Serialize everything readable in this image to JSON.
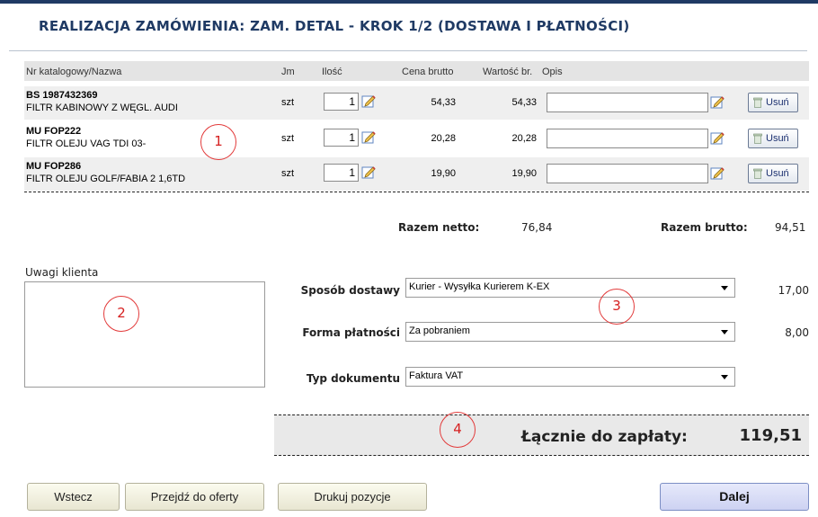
{
  "title": "REALIZACJA ZAMÓWIENIA: ZAM. DETAL - KROK 1/2 (DOSTAWA I PŁATNOŚCI)",
  "table": {
    "headers": {
      "name": "Nr katalogowy/Nazwa",
      "unit": "Jm",
      "qty": "Ilość",
      "price": "Cena brutto",
      "value": "Wartość br.",
      "desc": "Opis"
    },
    "rows": [
      {
        "code": "BS 1987432369",
        "name": "FILTR KABINOWY Z WĘGL. AUDI",
        "unit": "szt",
        "qty": "1",
        "price": "54,33",
        "value": "54,33",
        "desc": ""
      },
      {
        "code": "MU FOP222",
        "name": "FILTR OLEJU VAG TDI 03-",
        "unit": "szt",
        "qty": "1",
        "price": "20,28",
        "value": "20,28",
        "desc": ""
      },
      {
        "code": "MU FOP286",
        "name": "FILTR OLEJU GOLF/FABIA 2 1,6TD",
        "unit": "szt",
        "qty": "1",
        "price": "19,90",
        "value": "19,90",
        "desc": ""
      }
    ],
    "remove_label": "Usuń",
    "icons": {
      "edit": "edit-pencil-icon",
      "trash": "trash-icon"
    }
  },
  "totals": {
    "netto_label": "Razem netto:",
    "netto_value": "76,84",
    "brutto_label": "Razem brutto:",
    "brutto_value": "94,51"
  },
  "notes": {
    "label": "Uwagi klienta",
    "value": ""
  },
  "form": {
    "delivery": {
      "label": "Sposób dostawy",
      "value": "Kurier - Wysyłka Kurierem K-EX",
      "cost": "17,00"
    },
    "payment": {
      "label": "Forma płatności",
      "value": "Za pobraniem",
      "cost": "8,00"
    },
    "document": {
      "label": "Typ dokumentu",
      "value": "Faktura VAT"
    }
  },
  "grand_total": {
    "label": "Łącznie do zapłaty:",
    "value": "119,51"
  },
  "markers": [
    "1",
    "2",
    "3",
    "4"
  ],
  "buttons": {
    "back": "Wstecz",
    "offer": "Przejdź do oferty",
    "print": "Drukuj pozycje",
    "next": "Dalej"
  },
  "colors": {
    "title": "#1f3a64",
    "marker": "#e23a3a",
    "primary_button": "#cdd2f2"
  }
}
